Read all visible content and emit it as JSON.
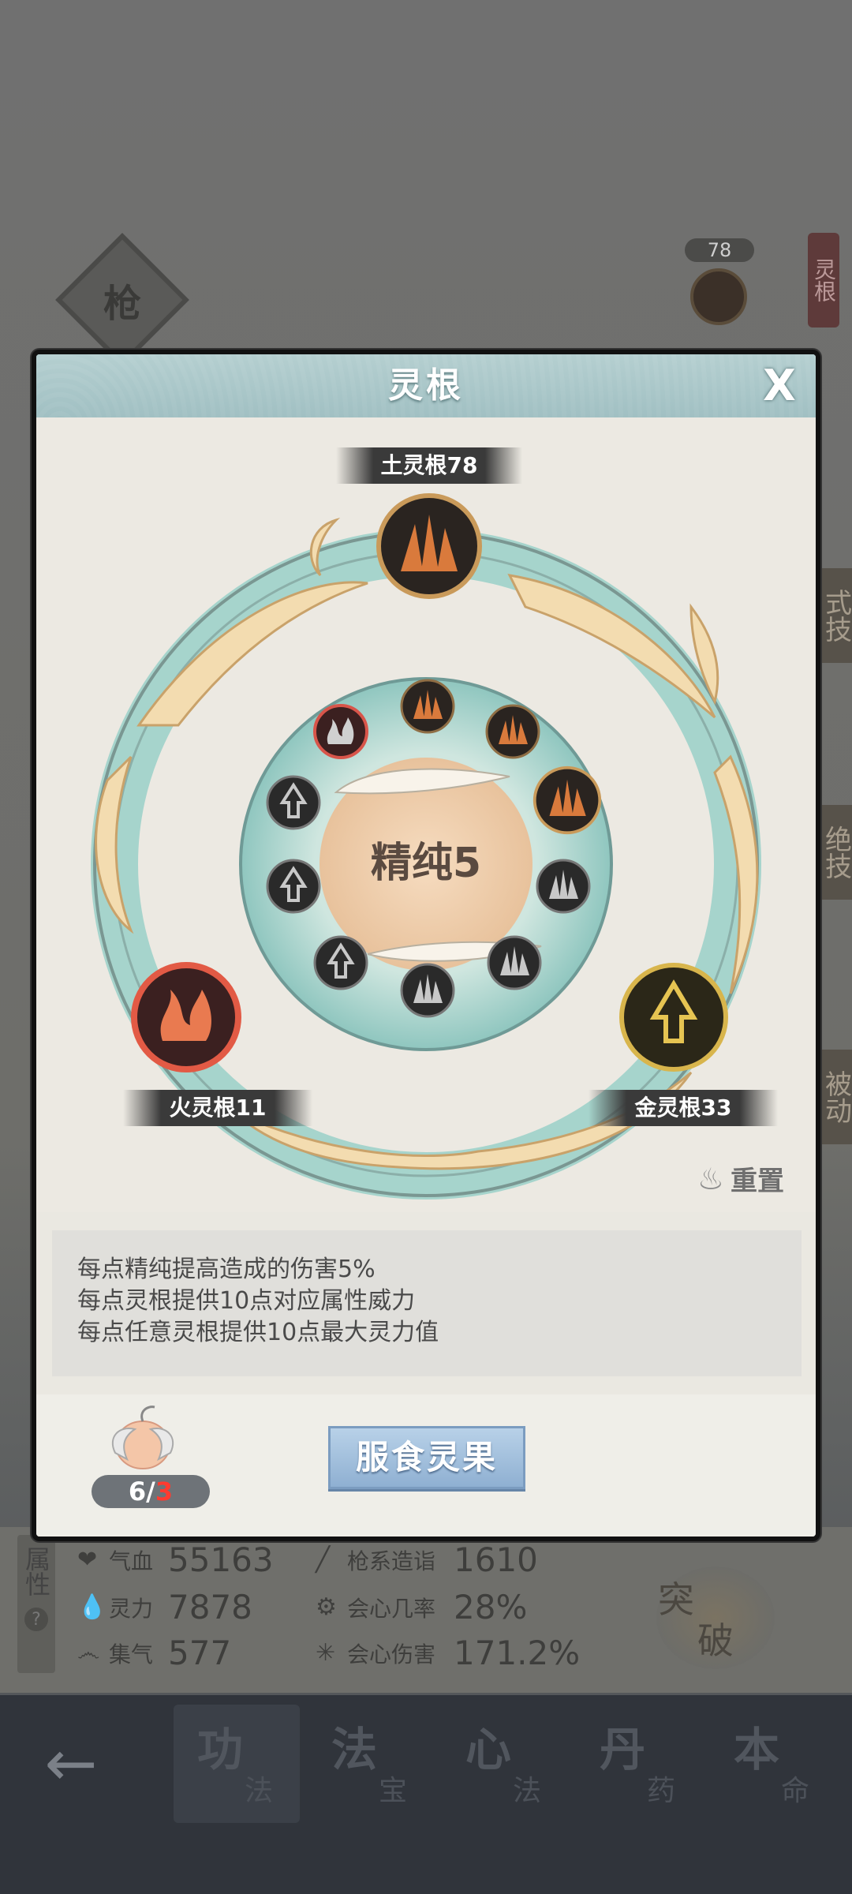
{
  "background": {
    "weapon_badge": "枪",
    "top_counter": "78",
    "top_ribbon": "灵根",
    "side_tabs": [
      "式技",
      "绝技",
      "被动"
    ],
    "attributes_tab": "属性",
    "stats": [
      {
        "icon": "heart-icon",
        "label": "气血",
        "value": "55163"
      },
      {
        "icon": "spear-icon",
        "label": "枪系造诣",
        "value": "1610"
      },
      {
        "icon": "drop-icon",
        "label": "灵力",
        "value": "7878"
      },
      {
        "icon": "crit-rate-icon",
        "label": "会心几率",
        "value": "28%"
      },
      {
        "icon": "swirl-icon",
        "label": "集气",
        "value": "577"
      },
      {
        "icon": "burst-icon",
        "label": "会心伤害",
        "value": "171.2%"
      }
    ],
    "breakthrough": [
      "突",
      "破"
    ],
    "nav": {
      "back": "←",
      "items": [
        {
          "big": "功",
          "small": "法",
          "active": true
        },
        {
          "big": "法",
          "small": "宝",
          "active": false
        },
        {
          "big": "心",
          "small": "法",
          "active": false
        },
        {
          "big": "丹",
          "small": "药",
          "active": false
        },
        {
          "big": "本",
          "small": "命",
          "active": false
        }
      ]
    }
  },
  "modal": {
    "title": "灵根",
    "close": "X",
    "earth_label": "土灵根78",
    "fire_label": "火灵根11",
    "metal_label": "金灵根33",
    "purity": "精纯5",
    "reset": "重置",
    "description": [
      "每点精纯提高造成的伤害5%",
      "每点灵根提供10点对应属性威力",
      "每点任意灵根提供10点最大灵力值"
    ],
    "fruit_count": "6",
    "fruit_sep": "/",
    "fruit_needed": "3",
    "eat_button": "服食灵果"
  },
  "colors": {
    "earth": "#c8652f",
    "fire": "#d95a3a",
    "metal": "#d4b448",
    "ring_teal": "#8fc8c2",
    "cloud_gold": "#f0d7a8",
    "button_blue": "#9dbbdc"
  }
}
